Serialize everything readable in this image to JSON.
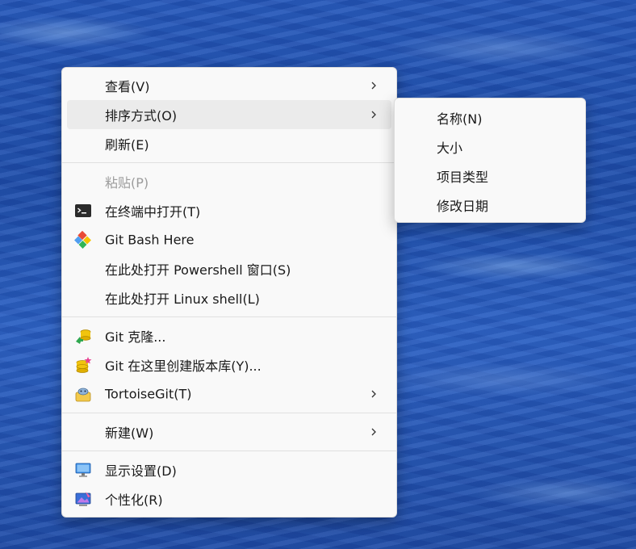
{
  "context_menu": {
    "groups": [
      {
        "items": [
          {
            "id": "view",
            "label": "查看(V)",
            "has_submenu": true
          },
          {
            "id": "sort",
            "label": "排序方式(O)",
            "has_submenu": true,
            "highlighted": true
          },
          {
            "id": "refresh",
            "label": "刷新(E)"
          }
        ]
      },
      {
        "items": [
          {
            "id": "paste",
            "label": "粘贴(P)",
            "disabled": true
          },
          {
            "id": "open-terminal",
            "label": "在终端中打开(T)",
            "icon": "terminal-icon"
          },
          {
            "id": "git-bash",
            "label": "Git Bash Here",
            "icon": "git-icon"
          },
          {
            "id": "powershell",
            "label": "在此处打开 Powershell 窗口(S)"
          },
          {
            "id": "linux-shell",
            "label": "在此处打开 Linux shell(L)"
          }
        ]
      },
      {
        "items": [
          {
            "id": "git-clone",
            "label": "Git 克隆...",
            "icon": "git-clone-icon"
          },
          {
            "id": "git-create-repo",
            "label": "Git 在这里创建版本库(Y)...",
            "icon": "git-repo-icon"
          },
          {
            "id": "tortoisegit",
            "label": "TortoiseGit(T)",
            "icon": "tortoisegit-icon",
            "has_submenu": true
          }
        ]
      },
      {
        "items": [
          {
            "id": "new",
            "label": "新建(W)",
            "has_submenu": true
          }
        ]
      },
      {
        "items": [
          {
            "id": "display-settings",
            "label": "显示设置(D)",
            "icon": "display-icon"
          },
          {
            "id": "personalize",
            "label": "个性化(R)",
            "icon": "personalize-icon"
          }
        ]
      }
    ]
  },
  "sort_submenu": {
    "items": [
      {
        "id": "sort-name",
        "label": "名称(N)"
      },
      {
        "id": "sort-size",
        "label": "大小"
      },
      {
        "id": "sort-type",
        "label": "项目类型"
      },
      {
        "id": "sort-date",
        "label": "修改日期"
      }
    ]
  },
  "colors": {
    "menu_background": "#f9f9f9",
    "highlight": "#ebebeb",
    "disabled_text": "#9c9c9c",
    "wallpaper_blue": "#1f4fae"
  }
}
